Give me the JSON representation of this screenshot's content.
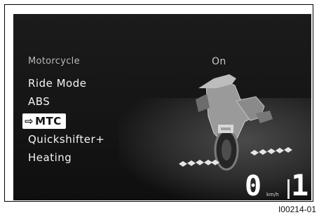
{
  "menu": {
    "header_label": "Motorcycle",
    "header_value": "On",
    "items": [
      "Ride Mode",
      "ABS",
      "MTC",
      "Quickshifter+",
      "Heating"
    ],
    "selected_index": 2,
    "selected_marker": "⇨"
  },
  "status": {
    "speed": "0",
    "speed_unit": "km/h",
    "gear": "1"
  },
  "figure_id": "I00214-01"
}
